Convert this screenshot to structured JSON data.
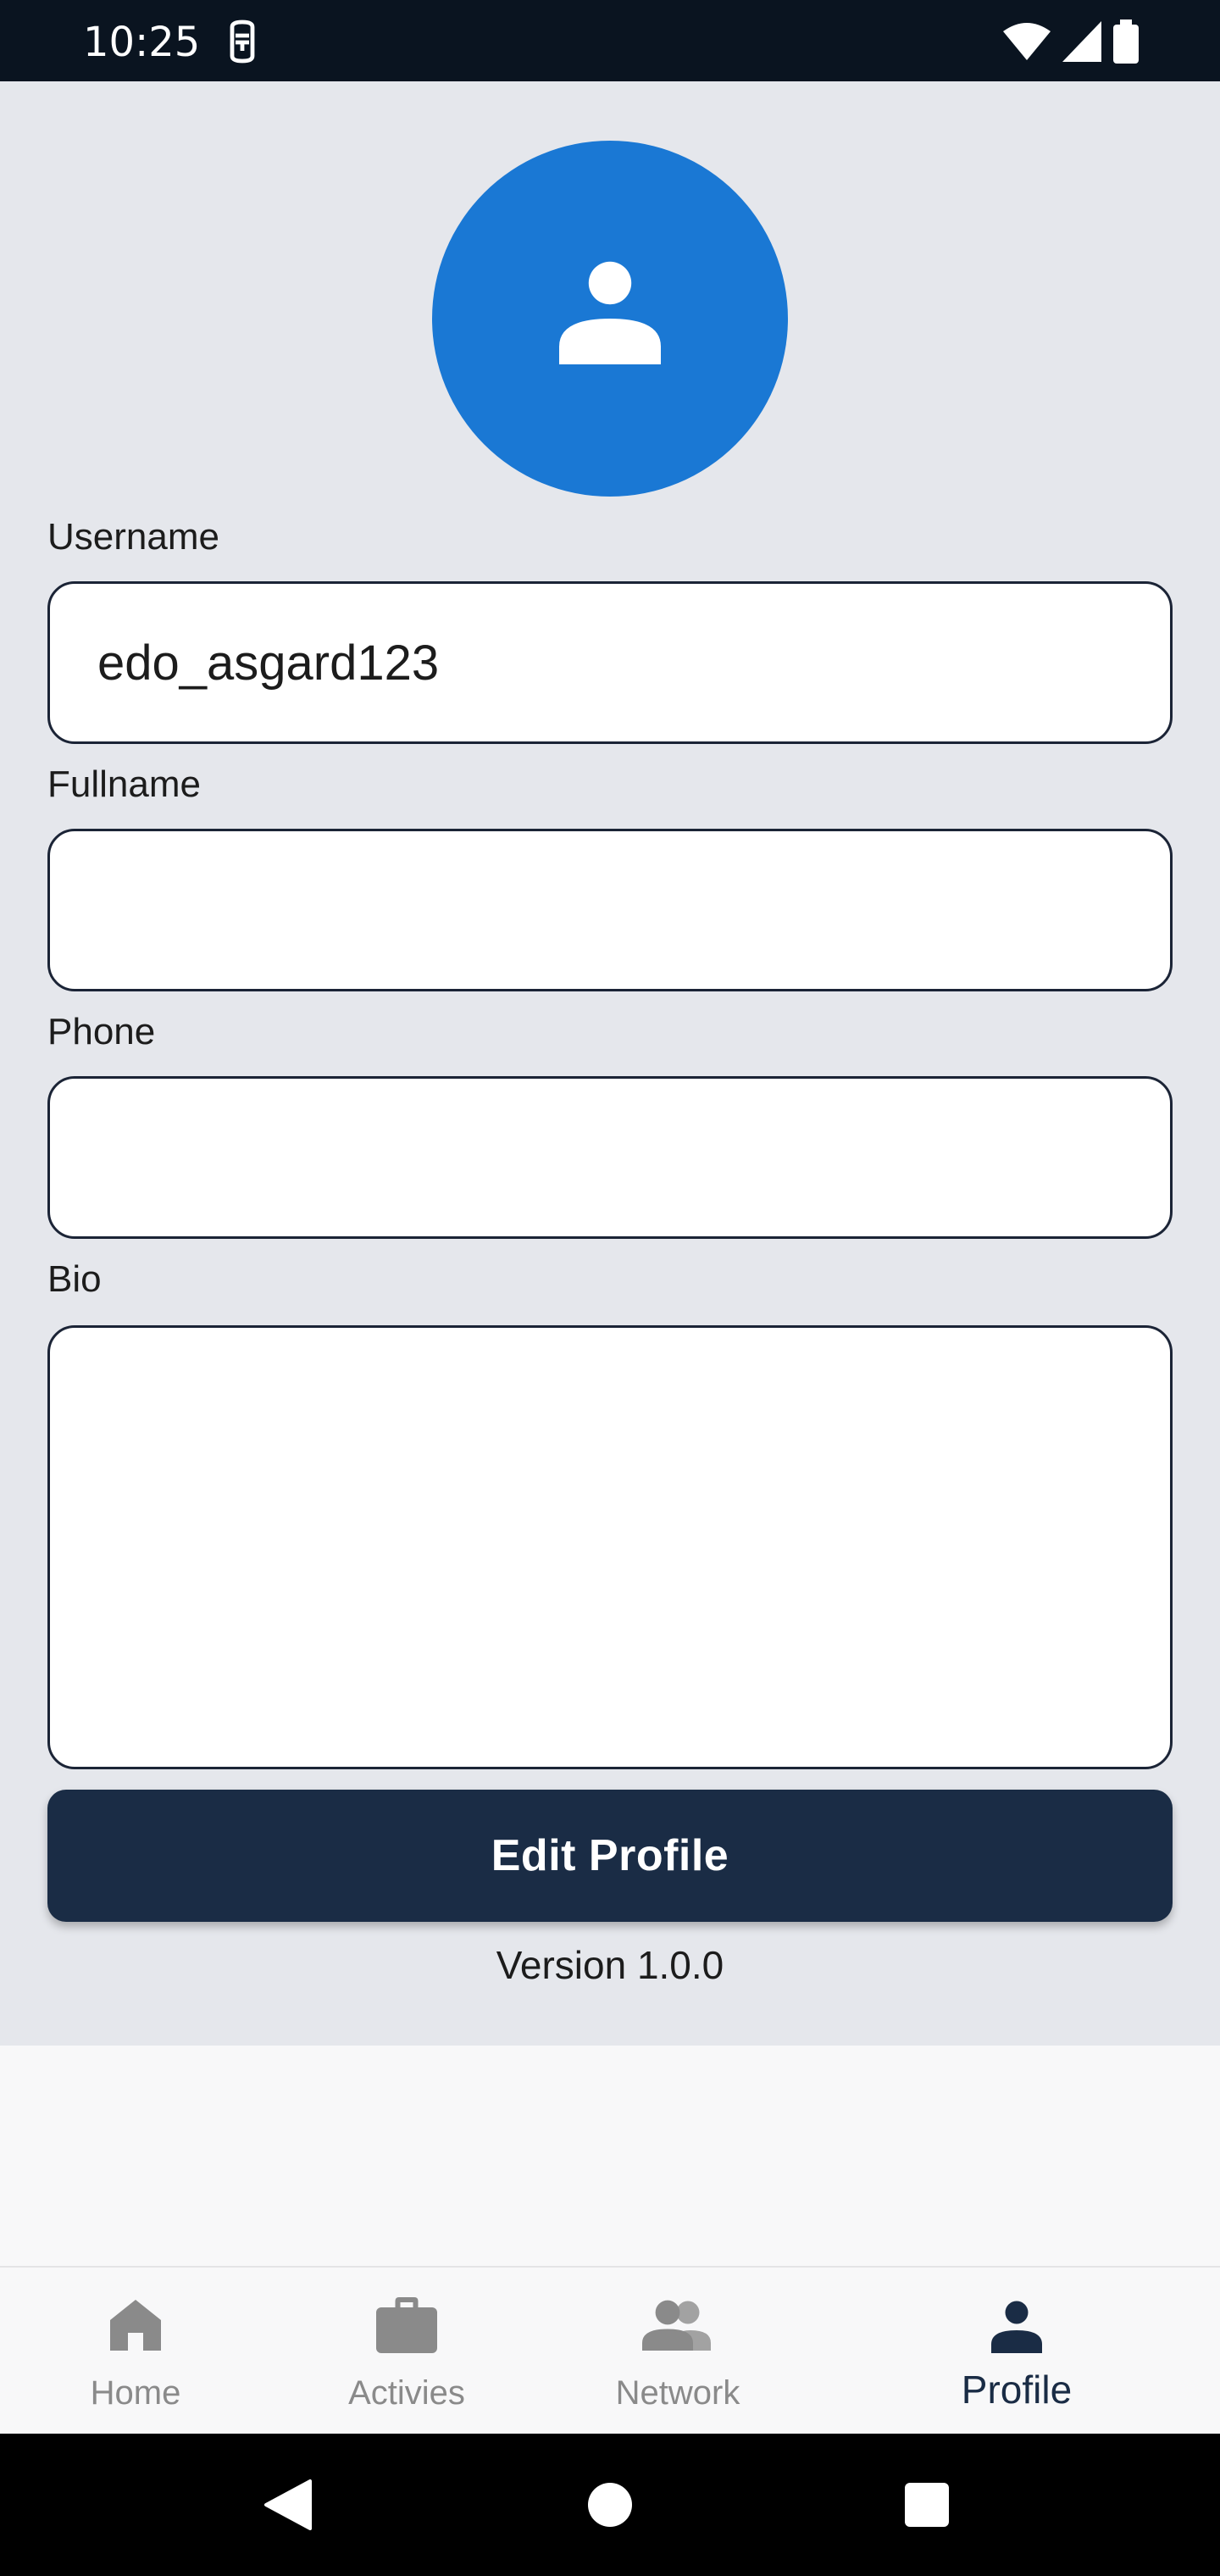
{
  "status_bar": {
    "time": "10:25"
  },
  "profile": {
    "fields": {
      "username_label": "Username",
      "username_value": "edo_asgard123",
      "fullname_label": "Fullname",
      "fullname_value": "",
      "phone_label": "Phone",
      "phone_value": "",
      "bio_label": "Bio",
      "bio_value": ""
    },
    "edit_button_label": "Edit Profile",
    "version": "Version 1.0.0"
  },
  "bottom_nav": {
    "items": [
      {
        "label": "Home",
        "icon": "home-icon",
        "active": false
      },
      {
        "label": "Activies",
        "icon": "briefcase-icon",
        "active": false
      },
      {
        "label": "Network",
        "icon": "people-icon",
        "active": false
      },
      {
        "label": "Profile",
        "icon": "person-icon",
        "active": true
      }
    ]
  },
  "colors": {
    "status_bar_bg": "#0a1420",
    "content_bg": "#e5e7ec",
    "avatar_bg": "#1a78d4",
    "button_bg": "#1a2c45",
    "nav_active": "#1a2c45",
    "nav_inactive": "#8a8a8a"
  }
}
